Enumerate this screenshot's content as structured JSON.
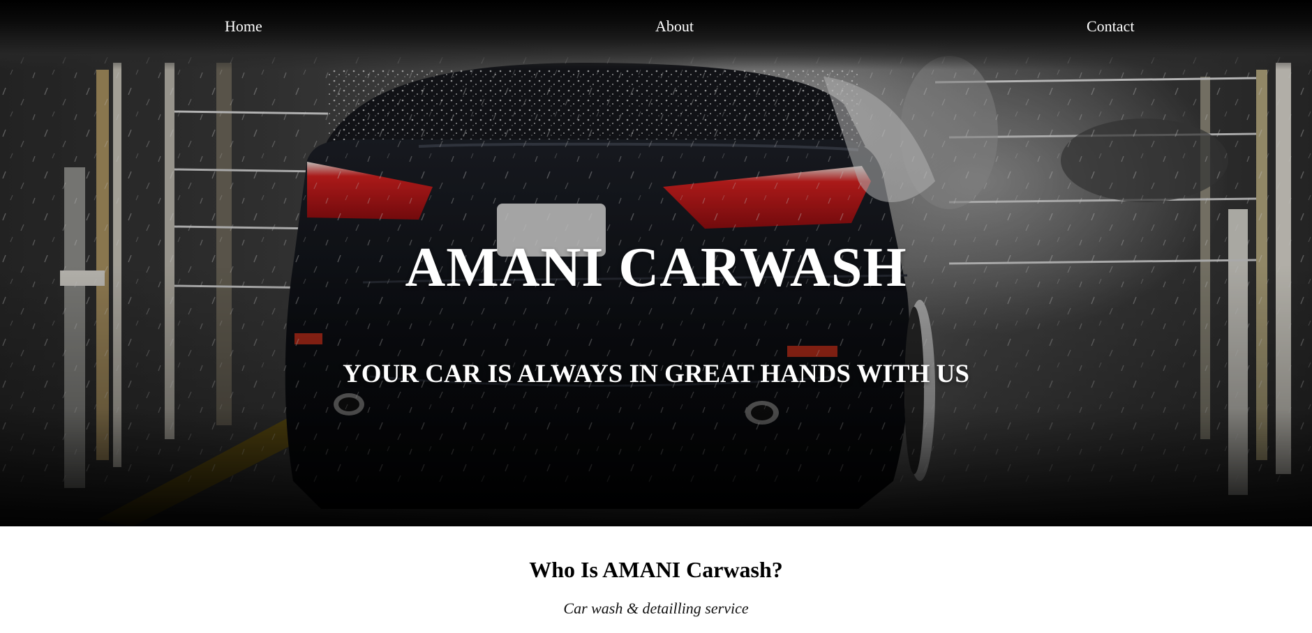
{
  "nav": {
    "items": [
      {
        "label": "Home"
      },
      {
        "label": "About"
      },
      {
        "label": "Contact"
      }
    ]
  },
  "hero": {
    "title": "AMANI CARWASH",
    "tagline": "YOUR CAR IS ALWAYS IN GREAT HANDS WITH US",
    "image_subject": "black sedan in car wash spray"
  },
  "about": {
    "heading": "Who Is AMANI Carwash?",
    "subheading": "Car wash & detailling service"
  },
  "colors": {
    "nav_bg": "#000000",
    "text_light": "#ffffff",
    "text_dark": "#000000",
    "tail_light": "#c8161a",
    "car_body": "#0f1116"
  }
}
